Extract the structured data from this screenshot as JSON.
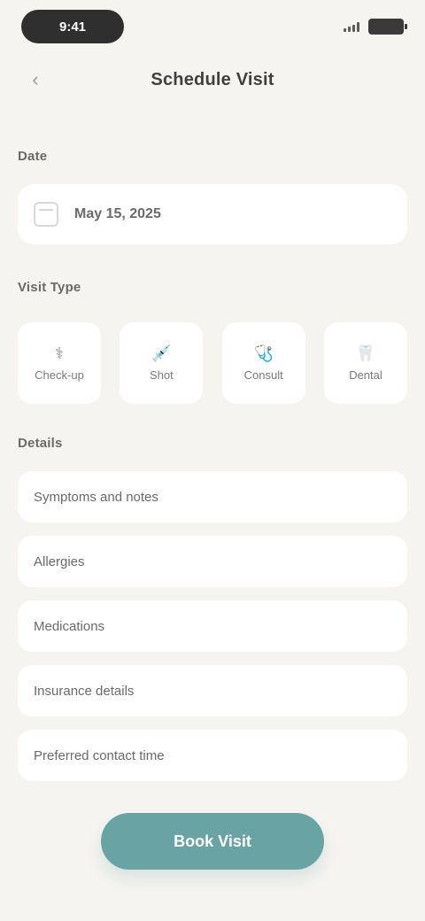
{
  "status_bar": {
    "time": "9:41"
  },
  "header": {
    "back_icon": "chevron-left-icon",
    "title": "Schedule Visit"
  },
  "sections": {
    "date_label": "Date",
    "visit_type_label": "Visit Type",
    "details_label": "Details"
  },
  "date": {
    "value": "May 15, 2025"
  },
  "visit_options": [
    {
      "emoji": "⚕",
      "label": "Check-up"
    },
    {
      "emoji": "💉",
      "label": "Shot"
    },
    {
      "emoji": "🩺",
      "label": "Consult"
    },
    {
      "emoji": "🦷",
      "label": "Dental"
    }
  ],
  "details": [
    {
      "label": "Symptoms and notes"
    },
    {
      "label": "Allergies"
    },
    {
      "label": "Medications"
    },
    {
      "label": "Insurance details"
    },
    {
      "label": "Preferred contact time"
    }
  ],
  "action": {
    "label": "Book Visit"
  },
  "colors": {
    "background": "#f6f4f1",
    "accent": "#6aa3a3",
    "surface": "#ffffff"
  }
}
